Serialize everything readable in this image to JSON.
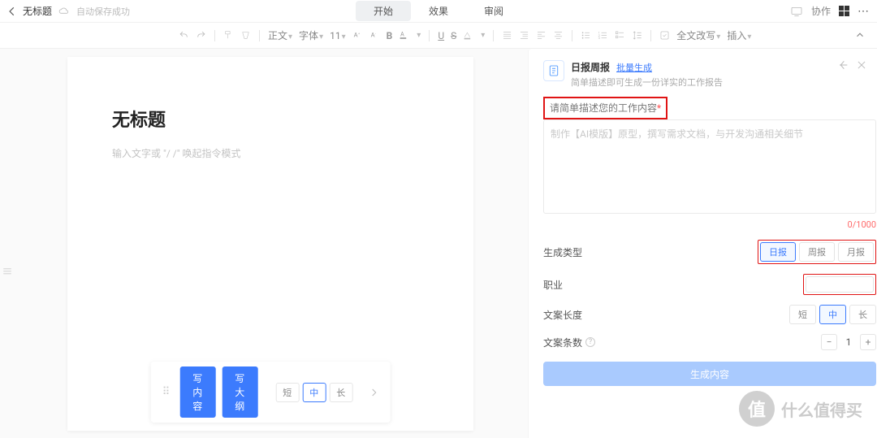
{
  "topbar": {
    "title": "无标题",
    "autosave": "自动保存成功",
    "tabs": {
      "start": "开始",
      "effect": "效果",
      "review": "审阅"
    },
    "collab": "协作"
  },
  "toolbar": {
    "para": "正文",
    "font": "字体",
    "size": "11",
    "rewrite": "全文改写",
    "insert": "插入"
  },
  "doc": {
    "heading": "无标题",
    "hint": "输入文字或 \"/ /\" 唤起指令模式"
  },
  "bottom": {
    "writeContent": "写内容",
    "writeOutline": "写大纲",
    "len": {
      "short": "短",
      "mid": "中",
      "long": "长"
    }
  },
  "panel": {
    "title": "日报周报",
    "batchLink": "批量生成",
    "subtitle": "简单描述即可生成一份详实的工作报告",
    "form": {
      "descLabel": "请简单描述您的工作内容",
      "descPlaceholder": "制作【AI模版】原型，撰写需求文档，与开发沟通相关细节",
      "counter": "0/1000",
      "typeLabel": "生成类型",
      "types": {
        "day": "日报",
        "week": "周报",
        "month": "月报"
      },
      "jobLabel": "职业",
      "lenLabel": "文案长度",
      "len": {
        "short": "短",
        "mid": "中",
        "long": "长"
      },
      "countLabel": "文案条数",
      "countValue": "1",
      "genBtn": "生成内容"
    }
  },
  "watermark": {
    "badge": "值",
    "text": "什么值得买"
  }
}
